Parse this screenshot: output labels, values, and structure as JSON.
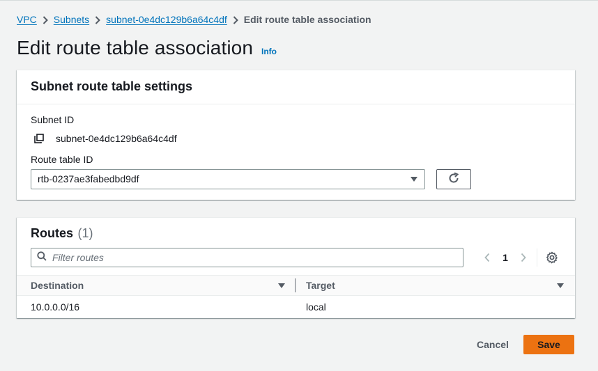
{
  "breadcrumb": {
    "items": [
      "VPC",
      "Subnets",
      "subnet-0e4dc129b6a64c4df"
    ],
    "current": "Edit route table association"
  },
  "page": {
    "title": "Edit route table association",
    "info_label": "Info"
  },
  "settings": {
    "header": "Subnet route table settings",
    "subnet_id_label": "Subnet ID",
    "subnet_id_value": "subnet-0e4dc129b6a64c4df",
    "route_table_label": "Route table ID",
    "route_table_selected": "rtb-0237ae3fabedbd9df"
  },
  "routes": {
    "title": "Routes",
    "count": "(1)",
    "filter_placeholder": "Filter routes",
    "current_page": "1",
    "columns": [
      "Destination",
      "Target"
    ],
    "rows": [
      {
        "destination": "10.0.0.0/16",
        "target": "local"
      }
    ]
  },
  "footer": {
    "cancel_label": "Cancel",
    "save_label": "Save"
  },
  "colors": {
    "link": "#0073bb",
    "primary_button": "#ec7211",
    "background": "#f2f3f3"
  },
  "icons": [
    "chevron-right-icon",
    "copy-icon",
    "caret-down-icon",
    "refresh-icon",
    "search-icon",
    "chevron-left-icon",
    "gear-icon",
    "sort-icon"
  ]
}
